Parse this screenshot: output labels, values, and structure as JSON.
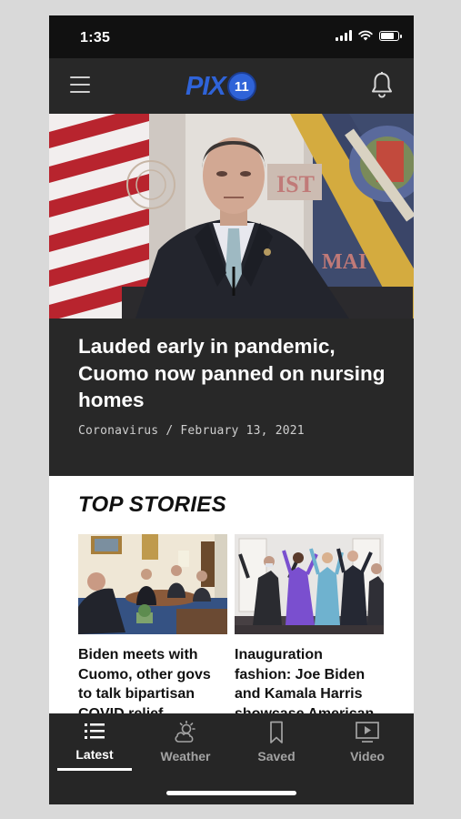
{
  "status_bar": {
    "time": "1:35",
    "battery_level": 0.85
  },
  "header": {
    "logo_text": "PIX",
    "logo_badge": "11"
  },
  "hero": {
    "title": "Lauded early in pandemic, Cuomo now panned on nursing homes",
    "category": "Coronavirus",
    "date": "February 13, 2021",
    "meta": "Coronavirus / February 13, 2021"
  },
  "top_stories": {
    "title": "TOP STORIES",
    "items": [
      {
        "title": "Biden meets with Cuomo, other govs to talk bipartisan COVID relief"
      },
      {
        "title": "Inauguration fashion: Joe Biden and Kamala Harris showcase American designers"
      }
    ]
  },
  "tabs": [
    {
      "label": "Latest",
      "icon": "list-icon",
      "active": true
    },
    {
      "label": "Weather",
      "icon": "weather-icon",
      "active": false
    },
    {
      "label": "Saved",
      "icon": "bookmark-icon",
      "active": false
    },
    {
      "label": "Video",
      "icon": "video-icon",
      "active": false
    }
  ],
  "colors": {
    "brand_blue": "#2f63d8",
    "header_bg": "#282828",
    "tab_bar_bg": "#262626",
    "inactive_tab": "#a3a3a3"
  }
}
